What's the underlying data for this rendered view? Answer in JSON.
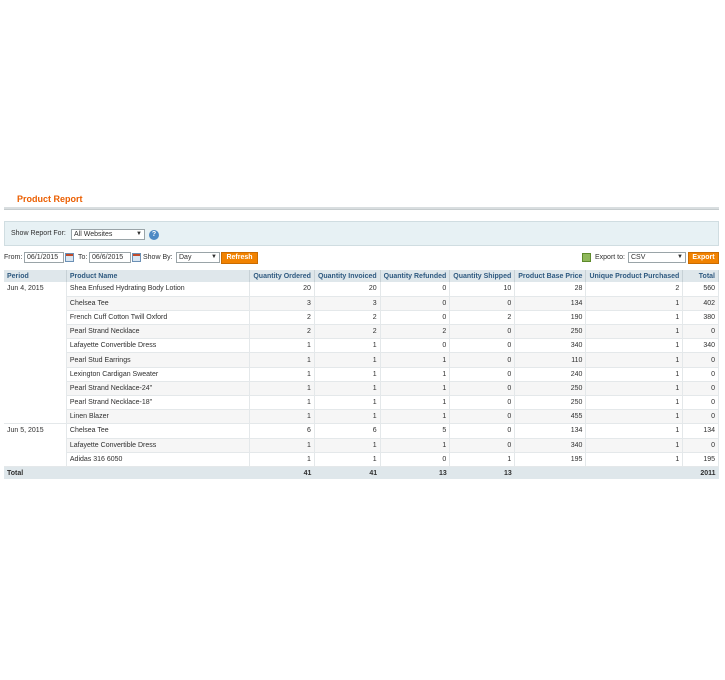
{
  "page": {
    "title": "Product Report"
  },
  "filter": {
    "label": "Show Report For:",
    "website": "All Websites",
    "help_symbol": "?"
  },
  "toolbar": {
    "from_label": "From:",
    "from_value": "06/1/2015",
    "to_label": "To:",
    "to_value": "06/6/2015",
    "show_by_label": "Show By:",
    "show_by_value": "Day",
    "refresh_label": "Refresh",
    "export_to_label": "Export to:",
    "export_format": "CSV",
    "export_label": "Export"
  },
  "table": {
    "headers": [
      "Period",
      "Product Name",
      "Quantity Ordered",
      "Quantity Invoiced",
      "Quantity Refunded",
      "Quantity Shipped",
      "Product Base Price",
      "Unique Product Purchased",
      "Total"
    ],
    "groups": [
      {
        "period": "Jun 4, 2015",
        "rows": [
          [
            "Shea Enfused Hydrating Body Lotion",
            "20",
            "20",
            "0",
            "10",
            "28",
            "2",
            "560"
          ],
          [
            "Chelsea Tee",
            "3",
            "3",
            "0",
            "0",
            "134",
            "1",
            "402"
          ],
          [
            "French Cuff Cotton Twill Oxford",
            "2",
            "2",
            "0",
            "2",
            "190",
            "1",
            "380"
          ],
          [
            "Pearl Strand Necklace",
            "2",
            "2",
            "2",
            "0",
            "250",
            "1",
            "0"
          ],
          [
            "Lafayette Convertible Dress",
            "1",
            "1",
            "0",
            "0",
            "340",
            "1",
            "340"
          ],
          [
            "Pearl Stud Earrings",
            "1",
            "1",
            "1",
            "0",
            "110",
            "1",
            "0"
          ],
          [
            "Lexington Cardigan Sweater",
            "1",
            "1",
            "1",
            "0",
            "240",
            "1",
            "0"
          ],
          [
            "Pearl Strand Necklace-24\"",
            "1",
            "1",
            "1",
            "0",
            "250",
            "1",
            "0"
          ],
          [
            "Pearl Strand Necklace-18\"",
            "1",
            "1",
            "1",
            "0",
            "250",
            "1",
            "0"
          ],
          [
            "Linen Blazer",
            "1",
            "1",
            "1",
            "0",
            "455",
            "1",
            "0"
          ]
        ]
      },
      {
        "period": "Jun 5, 2015",
        "rows": [
          [
            "Chelsea Tee",
            "6",
            "6",
            "5",
            "0",
            "134",
            "1",
            "134"
          ],
          [
            "Lafayette Convertible Dress",
            "1",
            "1",
            "1",
            "0",
            "340",
            "1",
            "0"
          ],
          [
            "Adidas 316 6050",
            "1",
            "1",
            "0",
            "1",
            "195",
            "1",
            "195"
          ]
        ]
      }
    ],
    "totals": [
      "Total",
      "",
      "41",
      "41",
      "13",
      "13",
      "",
      "",
      "2011"
    ]
  }
}
